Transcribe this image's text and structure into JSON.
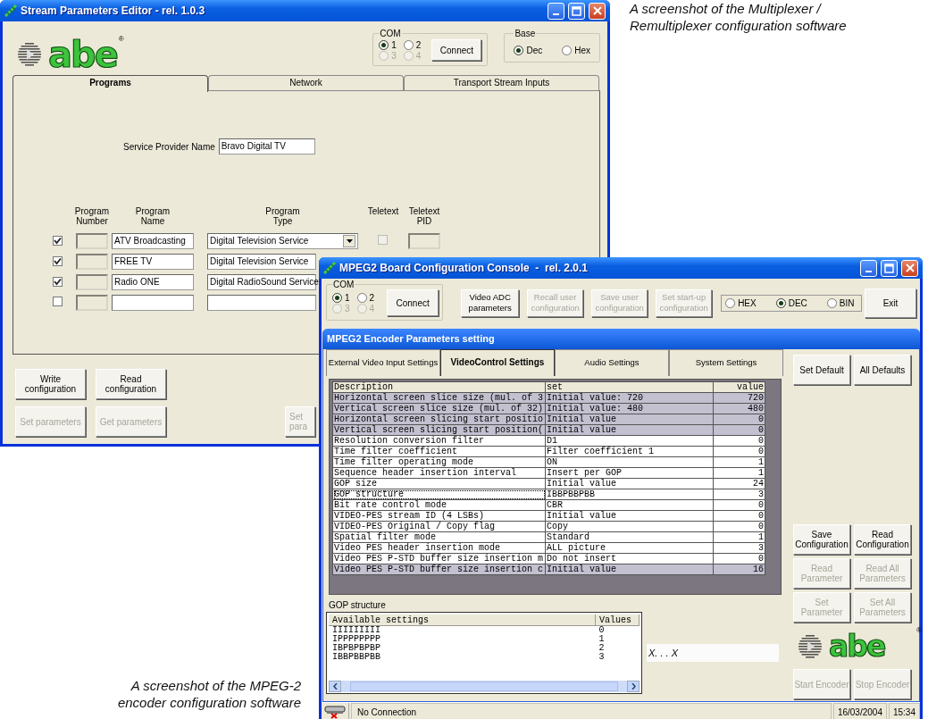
{
  "captions": [
    {
      "text": "A screenshot of the Multiplexer /\nRemultiplexer configuration software"
    },
    {
      "text": "A screenshot of the MPEG-2\nencoder configuration software"
    }
  ],
  "mux_window": {
    "title": "Stream Parameters Editor - rel. 1.0.3",
    "logo": {
      "text": "abe",
      "mark": "®"
    },
    "com": {
      "legend": "COM",
      "options": [
        {
          "label": "1",
          "selected": true,
          "disabled": false
        },
        {
          "label": "2",
          "selected": false,
          "disabled": false
        },
        {
          "label": "3",
          "selected": false,
          "disabled": true
        },
        {
          "label": "4",
          "selected": false,
          "disabled": true
        }
      ],
      "button": "Connect"
    },
    "base": {
      "legend": "Base",
      "options": [
        {
          "label": "Dec",
          "selected": true
        },
        {
          "label": "Hex",
          "selected": false
        }
      ]
    },
    "tabs": [
      {
        "label": "Programs",
        "selected": true
      },
      {
        "label": "Network",
        "selected": false
      },
      {
        "label": "Transport Stream Inputs",
        "selected": false
      }
    ],
    "service_provider": {
      "label": "Service Provider Name",
      "value": "Bravo Digital TV"
    },
    "columns": [
      "Program\nNumber",
      "Program\nName",
      "Program\nType",
      "Teletext",
      "Teletext\nPID"
    ],
    "programs": [
      {
        "checked": true,
        "name": "ATV Broadcasting",
        "type": "Digital Television Service",
        "dropdown": true,
        "teletext": false
      },
      {
        "checked": true,
        "name": "FREE TV",
        "type": "Digital Television Service"
      },
      {
        "checked": true,
        "name": "Radio ONE",
        "type": "Digital RadioSound Service"
      },
      {
        "checked": false
      }
    ],
    "buttons": [
      {
        "label": "Write\nconfiguration",
        "disabled": false
      },
      {
        "label": "Read\nconfiguration",
        "disabled": false
      },
      {
        "label": "Set parameters",
        "disabled": true
      },
      {
        "label": "Get parameters",
        "disabled": true
      },
      {
        "label": "Set\npara",
        "disabled": true
      }
    ]
  },
  "encoder_window": {
    "title": "MPEG2 Board Configuration Console  -  rel. 2.0.1",
    "com": {
      "legend": "COM",
      "options": [
        {
          "label": "1",
          "selected": true,
          "disabled": false
        },
        {
          "label": "2",
          "selected": false,
          "disabled": false
        },
        {
          "label": "3",
          "selected": false,
          "disabled": true
        },
        {
          "label": "4",
          "selected": false,
          "disabled": true
        }
      ],
      "button": "Connect"
    },
    "toolbar": [
      {
        "label": "Video ADC\nparameters",
        "disabled": false
      },
      {
        "label": "Recall user\nconfiguration",
        "disabled": true
      },
      {
        "label": "Save user\nconfiguration",
        "disabled": true
      },
      {
        "label": "Set start-up\nconfiguration",
        "disabled": true
      }
    ],
    "base": {
      "options": [
        {
          "label": "HEX",
          "selected": false
        },
        {
          "label": "DEC",
          "selected": true
        },
        {
          "label": "BIN",
          "selected": false
        }
      ]
    },
    "exit": "Exit",
    "panel_title": "MPEG2 Encoder Parameters setting",
    "tabs": [
      {
        "label": "External Video Input Settings",
        "selected": false
      },
      {
        "label": "VideoControl Settings",
        "selected": true
      },
      {
        "label": "Audio Settings",
        "selected": false
      },
      {
        "label": "System Settings",
        "selected": false
      }
    ],
    "side_buttons": [
      {
        "label": "Set Default",
        "disabled": false
      },
      {
        "label": "All Defaults",
        "disabled": false
      },
      {
        "label": "Save\nConfiguration",
        "disabled": false
      },
      {
        "label": "Read\nConfiguration",
        "disabled": false
      },
      {
        "label": "Read\nParameter",
        "disabled": true
      },
      {
        "label": "Read All\nParameters",
        "disabled": true
      },
      {
        "label": "Set\nParameter",
        "disabled": true
      },
      {
        "label": "Set All\nParameters",
        "disabled": true
      }
    ],
    "table": {
      "columns": [
        "Description",
        "set",
        "value"
      ],
      "rows": [
        {
          "description": "Horizontal screen slice size (mul. of 3",
          "set": "Initial value: 720",
          "value": "720",
          "highlighted": true,
          "selected": false
        },
        {
          "description": "Vertical screen slice size (mul. of 32)",
          "set": "Initial value: 480",
          "value": "480",
          "highlighted": true,
          "selected": false
        },
        {
          "description": "Horizontal screen slicing start positio",
          "set": "Initial value",
          "value": "0",
          "highlighted": true,
          "selected": false
        },
        {
          "description": "Vertical screen slicing start position(",
          "set": "Initial value",
          "value": "0",
          "highlighted": true,
          "selected": false
        },
        {
          "description": "Resolution conversion filter",
          "set": "D1",
          "value": "0",
          "highlighted": false,
          "selected": false
        },
        {
          "description": "Time filter coefficient",
          "set": "Filter coefficient 1",
          "value": "0",
          "highlighted": false,
          "selected": false
        },
        {
          "description": "Time filter operating mode",
          "set": "ON",
          "value": "1",
          "highlighted": false,
          "selected": false
        },
        {
          "description": "Sequence header insertion interval",
          "set": "Insert per GOP",
          "value": "1",
          "highlighted": false,
          "selected": false
        },
        {
          "description": "GOP size",
          "set": "Initial value",
          "value": "24",
          "highlighted": false,
          "selected": false
        },
        {
          "description": "GOP structure",
          "set": "IBBPBBPBB",
          "value": "3",
          "highlighted": false,
          "selected": true
        },
        {
          "description": "Bit rate control mode",
          "set": "CBR",
          "value": "0",
          "highlighted": false,
          "selected": false
        },
        {
          "description": "VIDEO-PES stream ID (4 LSBs)",
          "set": "Initial value",
          "value": "0",
          "highlighted": false,
          "selected": false
        },
        {
          "description": "VIDEO-PES Original / Copy flag",
          "set": "Copy",
          "value": "0",
          "highlighted": false,
          "selected": false
        },
        {
          "description": "Spatial filter mode",
          "set": "Standard",
          "value": "1",
          "highlighted": false,
          "selected": false
        },
        {
          "description": "Video PES header insertion mode",
          "set": "ALL picture",
          "value": "3",
          "highlighted": false,
          "selected": false
        },
        {
          "description": "Video PES P-STD buffer size insertion m",
          "set": "Do not insert",
          "value": "0",
          "highlighted": false,
          "selected": false
        },
        {
          "description": "Video PES P-STD buffer size insertion c",
          "set": "Initial value",
          "value": "16",
          "highlighted": true,
          "selected": false
        }
      ]
    },
    "list_label": "GOP structure",
    "list": {
      "columns": [
        "Available settings",
        "Values"
      ],
      "rows": [
        {
          "setting": "IIIIIIIII",
          "value": "0"
        },
        {
          "setting": "IPPPPPPPP",
          "value": "1"
        },
        {
          "setting": "IBPBPBPBP",
          "value": "2"
        },
        {
          "setting": "IBBPBBPBB",
          "value": "3"
        }
      ]
    },
    "pattern_field": "X. . . X",
    "logo": {
      "text": "abe",
      "mark": "®"
    },
    "encoder_buttons": [
      {
        "label": "Start Encoder",
        "disabled": true
      },
      {
        "label": "Stop Encoder",
        "disabled": true
      }
    ],
    "status": {
      "message": "No Connection",
      "date": "16/03/2004",
      "time": "15:34"
    }
  }
}
